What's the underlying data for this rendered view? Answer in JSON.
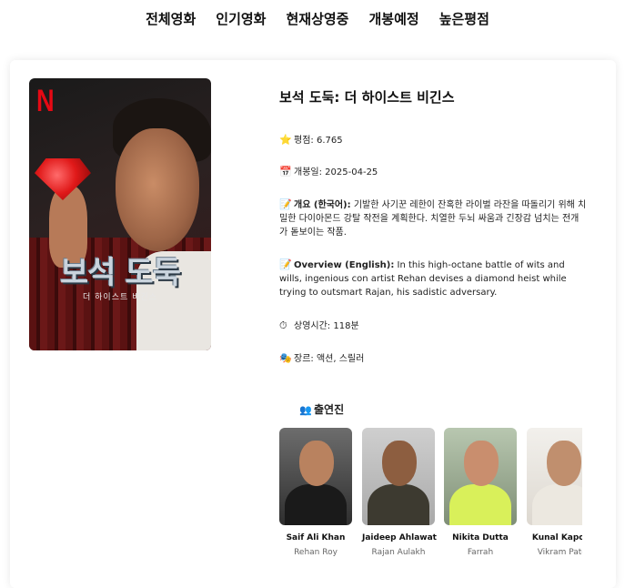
{
  "nav": {
    "items": [
      "전체영화",
      "인기영화",
      "현재상영중",
      "개봉예정",
      "높은평점"
    ]
  },
  "movie": {
    "title": "보석 도둑: 더 하이스트 비긴스",
    "poster": {
      "brand": "N",
      "title_art": "보석 도둑",
      "subtitle_art": "더 하이스트 비긴스"
    },
    "rating_label": "평점:",
    "rating_value": "6.765",
    "release_label": "개봉일:",
    "release_value": "2025-04-25",
    "overview_ko_label": "개요 (한국어):",
    "overview_ko": "기발한 사기꾼 레한이 잔혹한 라이벌 라잔을 따돌리기 위해 치밀한 다이아몬드 강탈 작전을 계획한다. 치열한 두뇌 싸움과 긴장감 넘치는 전개가 돋보이는 작품.",
    "overview_en_label": "Overview (English):",
    "overview_en": "In this high-octane battle of wits and wills, ingenious con artist Rehan devises a diamond heist while trying to outsmart Rajan, his sadistic adversary.",
    "runtime_label": "상영시간:",
    "runtime_value": "118분",
    "genre_label": "장르:",
    "genre_value": "액션, 스릴러",
    "cast_heading": "출연진"
  },
  "icons": {
    "rating": "star-icon",
    "release": "calendar-icon",
    "overview_ko": "memo-icon",
    "overview_en": "memo-icon",
    "runtime": "stopwatch-icon",
    "genre": "masks-icon",
    "cast": "people-icon"
  },
  "cast": [
    {
      "name": "Saif Ali Khan",
      "role": "Rehan Roy"
    },
    {
      "name": "Jaideep Ahlawat",
      "role": "Rajan Aulakh"
    },
    {
      "name": "Nikita Dutta",
      "role": "Farrah"
    },
    {
      "name": "Kunal Kapoor",
      "role": "Vikram Patel"
    }
  ],
  "colors": {
    "netflix_red": "#e50914",
    "text": "#111111",
    "muted": "#666666"
  }
}
